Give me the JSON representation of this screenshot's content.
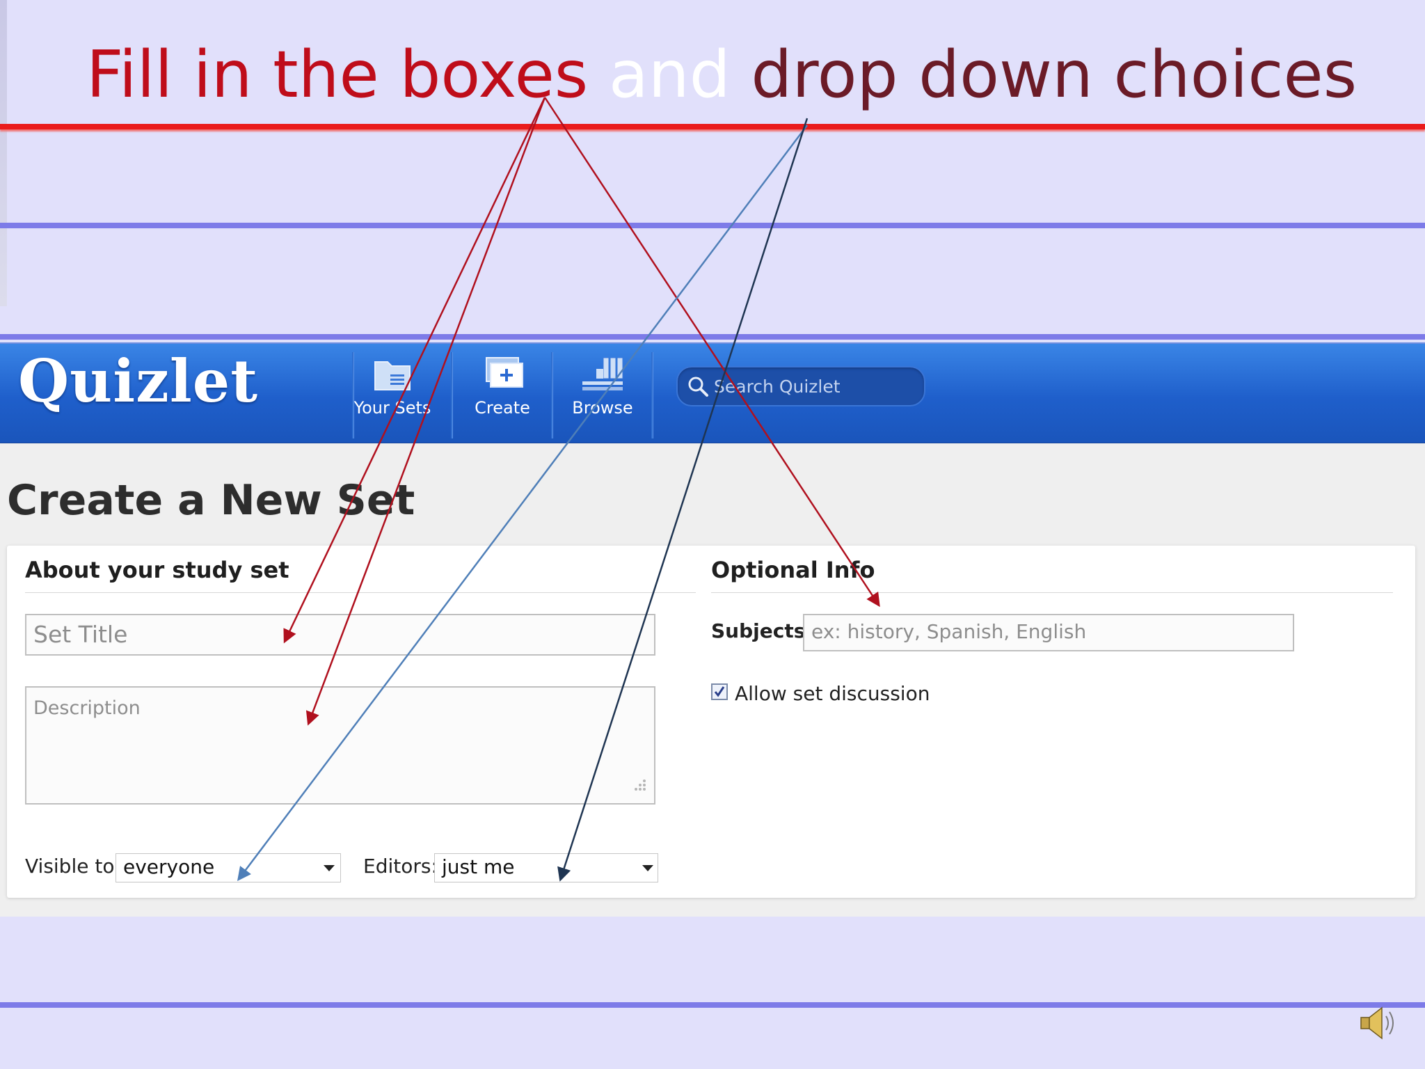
{
  "slide": {
    "title_part1": "Fill in the boxes ",
    "title_part2": "and",
    "title_part3": " drop down choices"
  },
  "navbar": {
    "logo": "Quizlet",
    "items": [
      {
        "label": "Your Sets",
        "icon": "folder-icon"
      },
      {
        "label": "Create",
        "icon": "create-plus-icon"
      },
      {
        "label": "Browse",
        "icon": "browse-cards-icon"
      }
    ],
    "search_placeholder": "Search Quizlet"
  },
  "page": {
    "title": "Create a New Set"
  },
  "about": {
    "heading": "About your study set",
    "title_placeholder": "Set Title",
    "description_placeholder": "Description",
    "visible_label": "Visible to:",
    "visible_value": "everyone",
    "editors_label": "Editors:",
    "editors_value": "just me"
  },
  "optional": {
    "heading": "Optional Info",
    "subjects_label": "Subjects:",
    "subjects_placeholder": "ex: history, Spanish, English",
    "discussion_label": "Allow set discussion",
    "discussion_checked": true
  },
  "colors": {
    "title_red": "#bf0d1a",
    "title_dark": "#6b1b27",
    "navbar_blue": "#1f5fcb",
    "arrow_red": "#b0101e",
    "arrow_steel": "#4f7fb8",
    "arrow_navy": "#1f3552"
  }
}
